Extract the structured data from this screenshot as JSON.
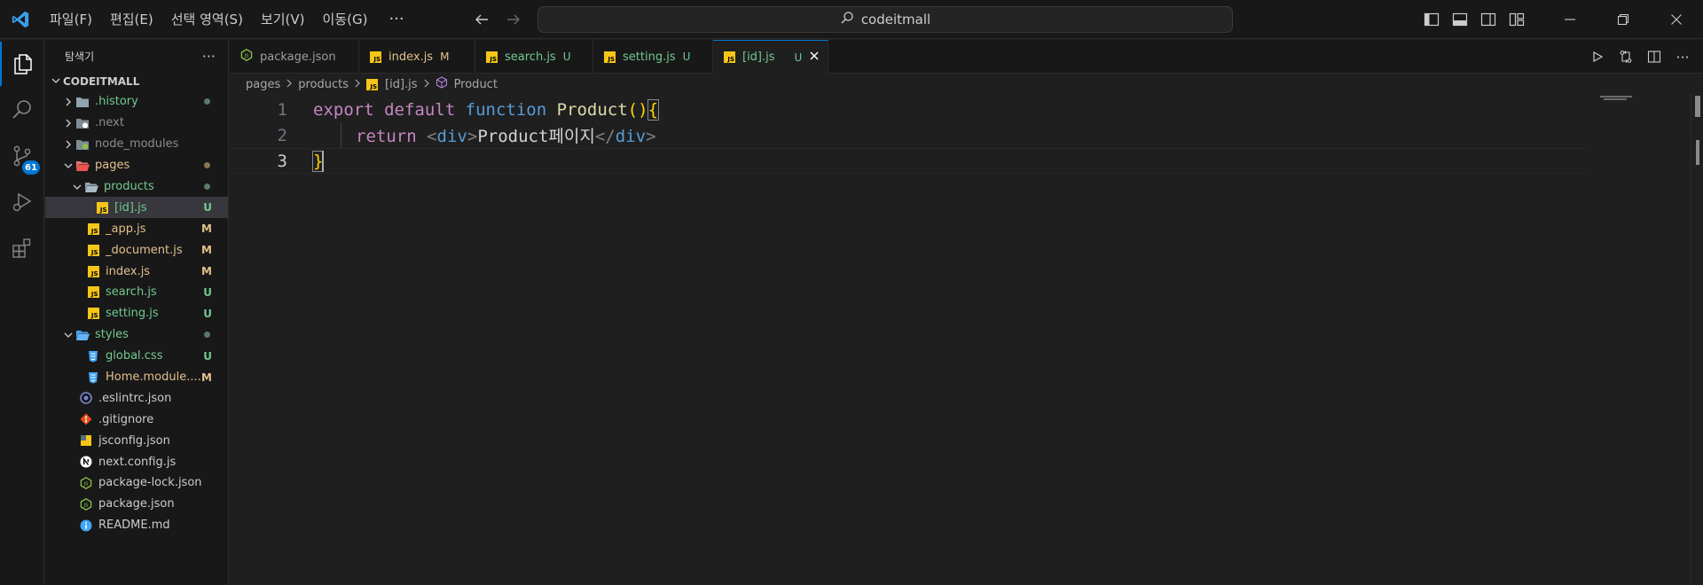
{
  "menu": {
    "items": [
      "파일(F)",
      "편집(E)",
      "선택 영역(S)",
      "보기(V)",
      "이동(G)"
    ],
    "more": "···"
  },
  "command_center": {
    "text": "codeitmall"
  },
  "activity": {
    "scm_badge": "61"
  },
  "sidebar": {
    "title": "탐색기",
    "more": "···",
    "root": "CODEITMALL",
    "items": [
      {
        "name": ".history",
        "status": ""
      },
      {
        "name": ".next",
        "status": ""
      },
      {
        "name": "node_modules",
        "status": ""
      },
      {
        "name": "pages",
        "status": ""
      },
      {
        "name": "products",
        "status": ""
      },
      {
        "name": "[id].js",
        "status": "U"
      },
      {
        "name": "_app.js",
        "status": "M"
      },
      {
        "name": "_document.js",
        "status": "M"
      },
      {
        "name": "index.js",
        "status": "M"
      },
      {
        "name": "search.js",
        "status": "U"
      },
      {
        "name": "setting.js",
        "status": "U"
      },
      {
        "name": "styles",
        "status": ""
      },
      {
        "name": "global.css",
        "status": "U"
      },
      {
        "name": "Home.module....",
        "status": "M"
      },
      {
        "name": ".eslintrc.json",
        "status": ""
      },
      {
        "name": ".gitignore",
        "status": ""
      },
      {
        "name": "jsconfig.json",
        "status": ""
      },
      {
        "name": "next.config.js",
        "status": ""
      },
      {
        "name": "package-lock.json",
        "status": ""
      },
      {
        "name": "package.json",
        "status": ""
      },
      {
        "name": "README.md",
        "status": ""
      }
    ]
  },
  "tabs": [
    {
      "label": "package.json",
      "status": ""
    },
    {
      "label": "index.js",
      "status": "M"
    },
    {
      "label": "search.js",
      "status": "U"
    },
    {
      "label": "setting.js",
      "status": "U"
    },
    {
      "label": "[id].js",
      "status": "U"
    }
  ],
  "breadcrumb": [
    "pages",
    "products",
    "[id].js",
    "Product"
  ],
  "editor": {
    "line_numbers": [
      "1",
      "2",
      "3"
    ],
    "line1": {
      "kw_export": "export",
      "kw_default": "default",
      "kw_function": "function",
      "fn_name": "Product",
      "paren": "()",
      "brace": "{"
    },
    "line2": {
      "kw_return": "return",
      "lt1": "<",
      "tag_open": "div",
      "gt1": ">",
      "text": "Product페이지",
      "lt2": "</",
      "tag_close": "div",
      "gt2": ">"
    },
    "line3": {
      "brace": "}"
    }
  },
  "colors": {
    "accent": "#0078d4",
    "modified": "#e2c08d",
    "untracked": "#73c991",
    "keyword": "#c586c0",
    "storage": "#569cd6",
    "function": "#dcdcaa",
    "bracket": "#ffd700"
  }
}
